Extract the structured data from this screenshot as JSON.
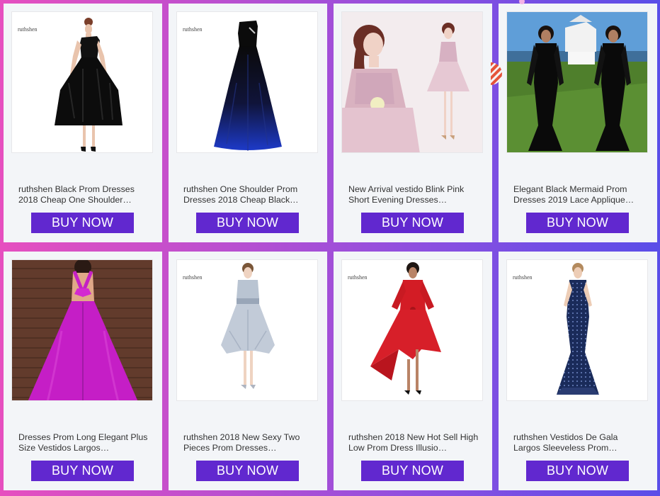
{
  "buy_label": "BUY NOW",
  "watermark": "ruthshen",
  "products": [
    {
      "title": "ruthshen Black Prom Dresses 2018 Cheap One Shoulder…",
      "image": "black one-shoulder tea-length tulle prom dress"
    },
    {
      "title": "ruthshen One Shoulder Prom Dresses 2018 Cheap Black…",
      "image": "black to royal blue ombre one-shoulder gown"
    },
    {
      "title": "New Arrival vestido Blink Pink Short Evening Dresses…",
      "image": "blush pink short sequined evening dress"
    },
    {
      "title": "Elegant Black Mermaid Prom Dresses 2019 Lace Applique…",
      "image": "black lace long-sleeve mermaid gown outdoors"
    },
    {
      "title": "Dresses Prom Long Elegant Plus Size Vestidos Largos…",
      "image": "magenta satin ball gown with bow back"
    },
    {
      "title": "ruthshen 2018 New Sexy Two Pieces Prom Dresses…",
      "image": "silver grey high-low two piece prom dress"
    },
    {
      "title": "ruthshen 2018 New Hot Sell High Low Prom Dress Illusio…",
      "image": "red lace high-low prom dress"
    },
    {
      "title": "ruthshen Vestidos De Gala Largos Sleeveless Prom…",
      "image": "navy blue beaded sleeveless mermaid gown"
    }
  ],
  "colors": {
    "button": "#6128cf",
    "card": "#f3f5f8",
    "text": "#333333"
  }
}
